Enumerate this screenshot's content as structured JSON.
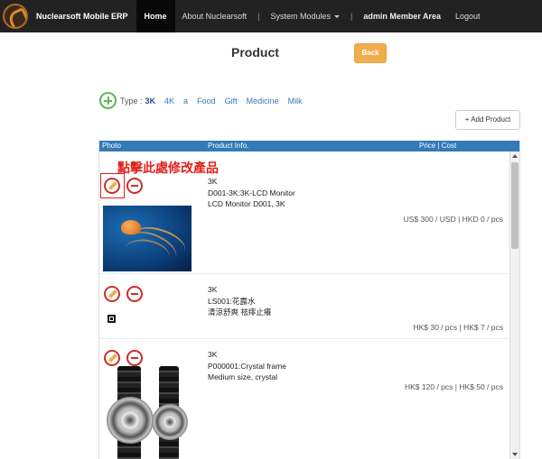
{
  "nav": {
    "brand": "Nuclearsoft Mobile ERP",
    "home": "Home",
    "about": "About Nuclearsoft",
    "sep": "|",
    "system_modules": "System Modules",
    "member": "admin Member Area",
    "logout": "Logout"
  },
  "page": {
    "title": "Product",
    "back": "Back",
    "add_product": "+ Add Product"
  },
  "types": {
    "label": "Type :",
    "items": [
      "3K",
      "4K",
      "a",
      "Food",
      "Gift",
      "Medicine",
      "Milk"
    ],
    "active": "3K"
  },
  "table": {
    "headers": {
      "photo": "Photo",
      "info": "Product Info.",
      "price": "Price | Cost"
    },
    "annotation": "點擊此處修改產品",
    "rows": [
      {
        "category": "3K",
        "code_name": "D001-3K:3K-LCD Monitor",
        "desc": "LCD Monitor D001, 3K",
        "price": "US$  300 / USD | HKD  0 / pcs"
      },
      {
        "category": "3K",
        "code_name": "LS001:花露水",
        "desc": "清涼舒爽 祛痱止癢",
        "price": "HK$  30 / pcs | HK$  7 / pcs"
      },
      {
        "category": "3K",
        "code_name": "P000001:Crystal frame",
        "desc": "Medium size, crystal",
        "price": "HK$  120 / pcs | HK$  50 / pcs"
      }
    ]
  },
  "colors": {
    "navbar": "#222222",
    "header_row": "#337ab7",
    "back_button": "#f0ad4e",
    "add_icon": "#5cb85c",
    "annotation": "#e0201a"
  }
}
